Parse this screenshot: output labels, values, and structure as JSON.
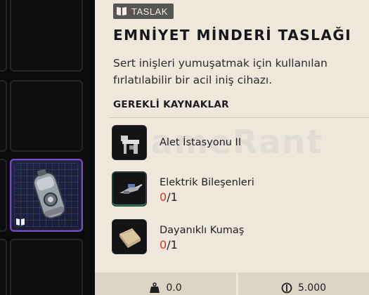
{
  "badge": {
    "label": "TASLAK",
    "icon": "book-icon"
  },
  "title": "EMNİYET MİNDERİ TASLAĞI",
  "description": "Sert inişleri yumuşatmak için kullanılan fırlatılabilir bir acil iniş cihazı.",
  "requirements": {
    "heading": "GEREKLİ KAYNAKLAR",
    "items": [
      {
        "name": "Alet İstasyonu II",
        "icon": "workbench-icon"
      },
      {
        "name": "Elektrik Bileşenleri",
        "have": "0",
        "need": "/1",
        "icon": "electrical-components-icon"
      },
      {
        "name": "Dayanıklı Kumaş",
        "have": "0",
        "need": "/1",
        "icon": "durable-fabric-icon"
      }
    ]
  },
  "footer": {
    "weight": {
      "value": "0.0",
      "icon": "weight-icon"
    },
    "price": {
      "value": "5.000",
      "icon": "coin-icon"
    }
  },
  "watermark": "GameRant"
}
